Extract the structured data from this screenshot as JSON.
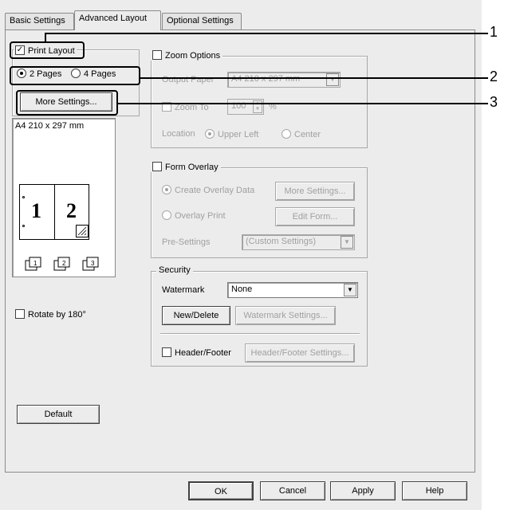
{
  "tabs": [
    {
      "label": "Basic Settings",
      "active": false
    },
    {
      "label": "Advanced Layout",
      "active": true
    },
    {
      "label": "Optional Settings",
      "active": false
    }
  ],
  "print_layout": {
    "label": "Print Layout",
    "checked": true,
    "radio_2": "2 Pages",
    "radio_4": "4 Pages",
    "more_settings": "More Settings..."
  },
  "preview": {
    "paper": "A4 210 x 297 mm",
    "page1": "1",
    "page2": "2"
  },
  "rotate": {
    "label": "Rotate by 180°"
  },
  "default_button": "Default",
  "zoom": {
    "label": "Zoom Options",
    "output_paper_label": "Output Paper",
    "output_paper_value": "A4 210 x 297 mm",
    "zoom_to_label": "Zoom To",
    "zoom_to_value": "100",
    "percent": "%",
    "location_label": "Location",
    "upper_left": "Upper Left",
    "center": "Center"
  },
  "form_overlay": {
    "label": "Form Overlay",
    "create": "Create Overlay Data",
    "more_settings": "More Settings...",
    "overlay_print": "Overlay Print",
    "edit_form": "Edit Form...",
    "pre_settings_label": "Pre-Settings",
    "pre_settings_value": "(Custom Settings)"
  },
  "security": {
    "label": "Security",
    "watermark_label": "Watermark",
    "watermark_value": "None",
    "new_delete": "New/Delete",
    "watermark_settings": "Watermark Settings...",
    "header_footer_label": "Header/Footer",
    "header_footer_settings": "Header/Footer Settings..."
  },
  "bottom_buttons": {
    "ok": "OK",
    "cancel": "Cancel",
    "apply": "Apply",
    "help": "Help"
  },
  "callouts": [
    "1",
    "2",
    "3"
  ]
}
